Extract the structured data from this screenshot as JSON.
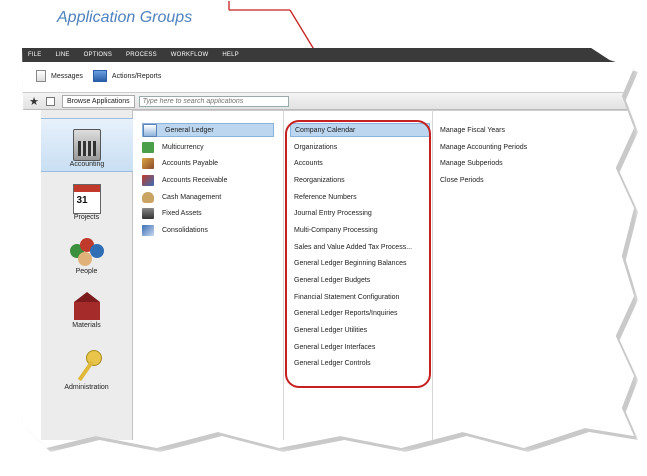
{
  "annotation": {
    "label": "Application Groups"
  },
  "menubar": {
    "items": [
      "FILE",
      "LINE",
      "OPTIONS",
      "PROCESS",
      "WORKFLOW",
      "HELP"
    ]
  },
  "toolbar": {
    "messages_label": "Messages",
    "actions_label": "Actions/Reports"
  },
  "browse": {
    "tab_label": "Browse Applications",
    "search_placeholder": "Type here to search applications"
  },
  "sidebar": {
    "items": [
      {
        "label": "Accounting",
        "icon": "calculator-icon",
        "selected": true
      },
      {
        "label": "Projects",
        "icon": "calendar-icon",
        "calendar_number": "31",
        "selected": false
      },
      {
        "label": "People",
        "icon": "people-icon",
        "selected": false
      },
      {
        "label": "Materials",
        "icon": "warehouse-icon",
        "selected": false
      },
      {
        "label": "Administration",
        "icon": "key-icon",
        "selected": false
      }
    ]
  },
  "groups": {
    "items": [
      {
        "label": "General Ledger",
        "icon": "ledger-icon",
        "selected": true
      },
      {
        "label": "Multicurrency",
        "icon": "currency-icon",
        "selected": false
      },
      {
        "label": "Accounts Payable",
        "icon": "payable-icon",
        "selected": false
      },
      {
        "label": "Accounts Receivable",
        "icon": "receivable-icon",
        "selected": false
      },
      {
        "label": "Cash Management",
        "icon": "cash-bag-icon",
        "selected": false
      },
      {
        "label": "Fixed Assets",
        "icon": "fixed-assets-icon",
        "selected": false
      },
      {
        "label": "Consolidations",
        "icon": "consolidations-icon",
        "selected": false
      }
    ]
  },
  "subgroups": {
    "items": [
      "Company Calendar",
      "Organizations",
      "Accounts",
      "Reorganizations",
      "Reference Numbers",
      "Journal Entry Processing",
      "Multi-Company Processing",
      "Sales and Value Added Tax Process...",
      "General Ledger Beginning Balances",
      "General Ledger Budgets",
      "Financial Statement Configuration",
      "General Ledger Reports/Inquiries",
      "General Ledger Utilities",
      "General Ledger Interfaces",
      "General Ledger Controls"
    ]
  },
  "applications": {
    "items": [
      "Manage Fiscal Years",
      "Manage Accounting Periods",
      "Manage Subperiods",
      "Close Periods"
    ]
  },
  "colors": {
    "highlight": "#c62121",
    "annotation": "#4f81bd",
    "selection": "#bcd6f0"
  }
}
